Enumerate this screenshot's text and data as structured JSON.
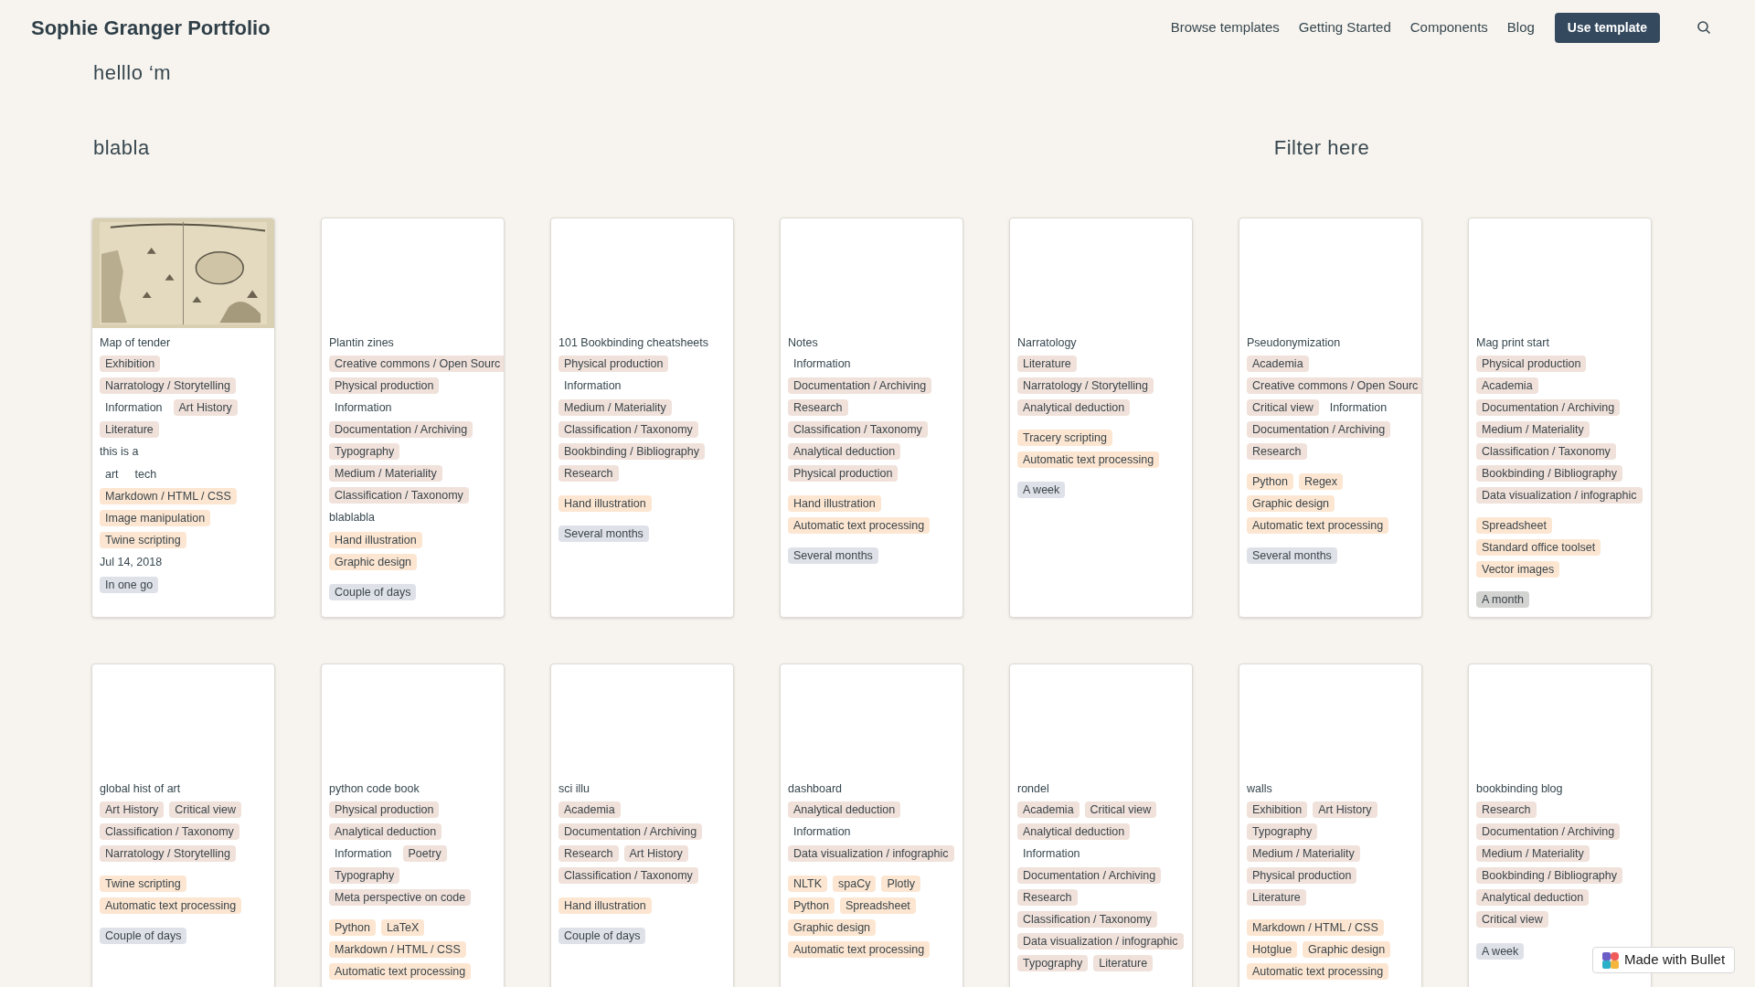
{
  "header": {
    "title": "Sophie Granger Portfolio",
    "nav": [
      "Browse templates",
      "Getting Started",
      "Components",
      "Blog"
    ],
    "cta": "Use template"
  },
  "greeting": "helllo ‘m",
  "section_title": "blabla",
  "filter_label": "Filter here",
  "cards": [
    {
      "title": "Map of tender",
      "image": {
        "kind": "picture"
      },
      "groups": [
        {
          "kind": "tags",
          "color": "#f0e1da",
          "tags": [
            {
              "label": "Exhibition",
              "kind": "pill"
            },
            {
              "label": "Narratology / Storytelling",
              "kind": "pill"
            },
            {
              "label": "Information",
              "kind": "plain"
            },
            {
              "label": "Art History",
              "kind": "pill"
            },
            {
              "label": "Literature",
              "kind": "pill"
            }
          ]
        },
        {
          "kind": "text",
          "text": "this is a"
        },
        {
          "kind": "tags",
          "color": "#fce6d1",
          "tags": [
            {
              "label": "art",
              "kind": "plain"
            },
            {
              "label": "tech",
              "kind": "plain"
            },
            {
              "label": "Markdown / HTML / CSS",
              "kind": "pill"
            },
            {
              "label": "Image manipulation",
              "kind": "pill"
            },
            {
              "label": "Twine scripting",
              "kind": "pill"
            }
          ]
        },
        {
          "kind": "text",
          "text": "Jul 14, 2018"
        },
        {
          "kind": "tags",
          "color": "#dfe1e9",
          "tags": [
            {
              "label": "In one go",
              "kind": "pill"
            }
          ]
        }
      ]
    },
    {
      "title": "Plantin zines",
      "groups": [
        {
          "kind": "tags",
          "color": "#f0e1da",
          "tags": [
            {
              "label": "Creative commons / Open Sourc",
              "kind": "pill"
            },
            {
              "label": "Physical production",
              "kind": "pill"
            },
            {
              "label": "Information",
              "kind": "plain"
            },
            {
              "label": "Documentation / Archiving",
              "kind": "pill"
            },
            {
              "label": "Typography",
              "kind": "pill"
            },
            {
              "label": "Medium / Materiality",
              "kind": "pill"
            },
            {
              "label": "Classification / Taxonomy",
              "kind": "pill"
            }
          ]
        },
        {
          "kind": "text",
          "text": "blablabla"
        },
        {
          "kind": "tags",
          "color": "#fce6d1",
          "tags": [
            {
              "label": "Hand illustration",
              "kind": "pill"
            },
            {
              "label": "Graphic design",
              "kind": "pill"
            }
          ]
        },
        {
          "kind": "tags",
          "color": "#dfe1e9",
          "tags": [
            {
              "label": "Couple of days",
              "kind": "pill"
            }
          ]
        }
      ]
    },
    {
      "title": "101 Bookbinding cheatsheets",
      "groups": [
        {
          "kind": "tags",
          "color": "#f0e1da",
          "tags": [
            {
              "label": "Physical production",
              "kind": "pill"
            },
            {
              "label": "Information",
              "kind": "plain"
            },
            {
              "label": "Medium / Materiality",
              "kind": "pill"
            },
            {
              "label": "Classification / Taxonomy",
              "kind": "pill"
            },
            {
              "label": "Bookbinding / Bibliography",
              "kind": "pill"
            },
            {
              "label": "Research",
              "kind": "pill"
            }
          ]
        },
        {
          "kind": "tags",
          "color": "#fce6d1",
          "tags": [
            {
              "label": "Hand illustration",
              "kind": "pill"
            }
          ]
        },
        {
          "kind": "tags",
          "color": "#dfe1e9",
          "tags": [
            {
              "label": "Several months",
              "kind": "pill"
            }
          ]
        }
      ]
    },
    {
      "title": "Notes",
      "groups": [
        {
          "kind": "tags",
          "color": "#f0e1da",
          "tags": [
            {
              "label": "Information",
              "kind": "plain"
            },
            {
              "label": "Documentation / Archiving",
              "kind": "pill"
            },
            {
              "label": "Research",
              "kind": "pill"
            },
            {
              "label": "Classification / Taxonomy",
              "kind": "pill"
            },
            {
              "label": "Analytical deduction",
              "kind": "pill"
            },
            {
              "label": "Physical production",
              "kind": "pill"
            }
          ]
        },
        {
          "kind": "tags",
          "color": "#fce6d1",
          "tags": [
            {
              "label": "Hand illustration",
              "kind": "pill"
            },
            {
              "label": "Automatic text processing",
              "kind": "pill"
            }
          ]
        },
        {
          "kind": "tags",
          "color": "#dfe1e9",
          "tags": [
            {
              "label": "Several months",
              "kind": "pill"
            }
          ]
        }
      ]
    },
    {
      "title": "Narratology",
      "groups": [
        {
          "kind": "tags",
          "color": "#f0e1da",
          "tags": [
            {
              "label": "Literature",
              "kind": "pill"
            },
            {
              "label": "Narratology / Storytelling",
              "kind": "pill"
            },
            {
              "label": "Analytical deduction",
              "kind": "pill"
            }
          ]
        },
        {
          "kind": "tags",
          "color": "#fce6d1",
          "tags": [
            {
              "label": "Tracery scripting",
              "kind": "pill"
            },
            {
              "label": "Automatic text processing",
              "kind": "pill"
            }
          ]
        },
        {
          "kind": "tags",
          "color": "#dfe1e9",
          "tags": [
            {
              "label": "A week",
              "kind": "pill"
            }
          ]
        }
      ]
    },
    {
      "title": "Pseudonymization",
      "groups": [
        {
          "kind": "tags",
          "color": "#f0e1da",
          "tags": [
            {
              "label": "Academia",
              "kind": "pill"
            },
            {
              "label": "Creative commons / Open Sourc",
              "kind": "pill"
            },
            {
              "label": "Critical view",
              "kind": "pill"
            },
            {
              "label": "Information",
              "kind": "plain"
            },
            {
              "label": "Documentation / Archiving",
              "kind": "pill"
            },
            {
              "label": "Research",
              "kind": "pill"
            }
          ]
        },
        {
          "kind": "tags",
          "color": "#fce6d1",
          "tags": [
            {
              "label": "Python",
              "kind": "pill"
            },
            {
              "label": "Regex",
              "kind": "pill"
            },
            {
              "label": "Graphic design",
              "kind": "pill"
            },
            {
              "label": "Automatic text processing",
              "kind": "pill"
            }
          ]
        },
        {
          "kind": "tags",
          "color": "#dfe1e9",
          "tags": [
            {
              "label": "Several months",
              "kind": "pill"
            }
          ]
        }
      ]
    },
    {
      "title": "Mag print start",
      "groups": [
        {
          "kind": "tags",
          "color": "#f0e1da",
          "tags": [
            {
              "label": "Physical production",
              "kind": "pill"
            },
            {
              "label": "Academia",
              "kind": "pill"
            },
            {
              "label": "Documentation / Archiving",
              "kind": "pill"
            },
            {
              "label": "Medium / Materiality",
              "kind": "pill"
            },
            {
              "label": "Classification / Taxonomy",
              "kind": "pill"
            },
            {
              "label": "Bookbinding / Bibliography",
              "kind": "pill"
            },
            {
              "label": "Data visualization / infographic",
              "kind": "pill"
            }
          ]
        },
        {
          "kind": "tags",
          "color": "#fce6d1",
          "tags": [
            {
              "label": "Spreadsheet",
              "kind": "pill"
            },
            {
              "label": "Standard office toolset",
              "kind": "pill"
            },
            {
              "label": "Vector images",
              "kind": "pill"
            }
          ]
        },
        {
          "kind": "tags",
          "color": "#d3d3d1",
          "tags": [
            {
              "label": "A month",
              "kind": "pill"
            }
          ]
        }
      ]
    },
    {
      "title": "global hist of art",
      "groups": [
        {
          "kind": "tags",
          "color": "#f0e1da",
          "tags": [
            {
              "label": "Art History",
              "kind": "pill"
            },
            {
              "label": "Critical view",
              "kind": "pill"
            },
            {
              "label": "Classification / Taxonomy",
              "kind": "pill"
            },
            {
              "label": "Narratology / Storytelling",
              "kind": "pill"
            }
          ]
        },
        {
          "kind": "tags",
          "color": "#fce6d1",
          "tags": [
            {
              "label": "Twine scripting",
              "kind": "pill"
            },
            {
              "label": "Automatic text processing",
              "kind": "pill"
            }
          ]
        },
        {
          "kind": "tags",
          "color": "#dfe1e9",
          "tags": [
            {
              "label": "Couple of days",
              "kind": "pill"
            }
          ]
        }
      ]
    },
    {
      "title": "python code book",
      "groups": [
        {
          "kind": "tags",
          "color": "#f0e1da",
          "tags": [
            {
              "label": "Physical production",
              "kind": "pill"
            },
            {
              "label": "Analytical deduction",
              "kind": "pill"
            },
            {
              "label": "Information",
              "kind": "plain"
            },
            {
              "label": "Poetry",
              "kind": "pill"
            },
            {
              "label": "Typography",
              "kind": "pill"
            },
            {
              "label": "Meta perspective on code",
              "kind": "pill"
            }
          ]
        },
        {
          "kind": "tags",
          "color": "#fce6d1",
          "tags": [
            {
              "label": "Python",
              "kind": "pill"
            },
            {
              "label": "LaTeX",
              "kind": "pill"
            },
            {
              "label": "Markdown / HTML / CSS",
              "kind": "pill"
            },
            {
              "label": "Automatic text processing",
              "kind": "pill"
            }
          ]
        }
      ]
    },
    {
      "title": "sci illu",
      "groups": [
        {
          "kind": "tags",
          "color": "#f0e1da",
          "tags": [
            {
              "label": "Academia",
              "kind": "pill"
            },
            {
              "label": "Documentation / Archiving",
              "kind": "pill"
            },
            {
              "label": "Research",
              "kind": "pill"
            },
            {
              "label": "Art History",
              "kind": "pill"
            },
            {
              "label": "Classification / Taxonomy",
              "kind": "pill"
            }
          ]
        },
        {
          "kind": "tags",
          "color": "#fce6d1",
          "tags": [
            {
              "label": "Hand illustration",
              "kind": "pill"
            }
          ]
        },
        {
          "kind": "tags",
          "color": "#dfe1e9",
          "tags": [
            {
              "label": "Couple of days",
              "kind": "pill"
            }
          ]
        }
      ]
    },
    {
      "title": "dashboard",
      "groups": [
        {
          "kind": "tags",
          "color": "#f0e1da",
          "tags": [
            {
              "label": "Analytical deduction",
              "kind": "pill"
            },
            {
              "label": "Information",
              "kind": "plain"
            },
            {
              "label": "Data visualization / infographic",
              "kind": "pill"
            }
          ]
        },
        {
          "kind": "tags",
          "color": "#fce6d1",
          "tags": [
            {
              "label": "NLTK",
              "kind": "pill"
            },
            {
              "label": "spaCy",
              "kind": "pill"
            },
            {
              "label": "Plotly",
              "kind": "pill"
            },
            {
              "label": "Python",
              "kind": "pill"
            },
            {
              "label": "Spreadsheet",
              "kind": "pill"
            },
            {
              "label": "Graphic design",
              "kind": "pill"
            },
            {
              "label": "Automatic text processing",
              "kind": "pill"
            }
          ]
        }
      ]
    },
    {
      "title": "rondel",
      "groups": [
        {
          "kind": "tags",
          "color": "#f0e1da",
          "tags": [
            {
              "label": "Academia",
              "kind": "pill"
            },
            {
              "label": "Critical view",
              "kind": "pill"
            },
            {
              "label": "Analytical deduction",
              "kind": "pill"
            },
            {
              "label": "Information",
              "kind": "plain"
            },
            {
              "label": "Documentation / Archiving",
              "kind": "pill"
            },
            {
              "label": "Research",
              "kind": "pill"
            },
            {
              "label": "Classification / Taxonomy",
              "kind": "pill"
            },
            {
              "label": "Data visualization / infographic",
              "kind": "pill"
            },
            {
              "label": "Typography",
              "kind": "pill"
            },
            {
              "label": "Literature",
              "kind": "pill"
            }
          ]
        }
      ]
    },
    {
      "title": "walls",
      "groups": [
        {
          "kind": "tags",
          "color": "#f0e1da",
          "tags": [
            {
              "label": "Exhibition",
              "kind": "pill"
            },
            {
              "label": "Art History",
              "kind": "pill"
            },
            {
              "label": "Typography",
              "kind": "pill"
            },
            {
              "label": "Medium / Materiality",
              "kind": "pill"
            },
            {
              "label": "Physical production",
              "kind": "pill"
            },
            {
              "label": "Literature",
              "kind": "pill"
            }
          ]
        },
        {
          "kind": "tags",
          "color": "#fce6d1",
          "tags": [
            {
              "label": "Markdown / HTML / CSS",
              "kind": "pill"
            },
            {
              "label": "Hotglue",
              "kind": "pill"
            },
            {
              "label": "Graphic design",
              "kind": "pill"
            },
            {
              "label": "Automatic text processing",
              "kind": "pill"
            }
          ]
        }
      ]
    },
    {
      "title": "bookbinding blog",
      "groups": [
        {
          "kind": "tags",
          "color": "#f0e1da",
          "tags": [
            {
              "label": "Research",
              "kind": "pill"
            },
            {
              "label": "Documentation / Archiving",
              "kind": "pill"
            },
            {
              "label": "Medium / Materiality",
              "kind": "pill"
            },
            {
              "label": "Bookbinding / Bibliography",
              "kind": "pill"
            },
            {
              "label": "Analytical deduction",
              "kind": "pill"
            },
            {
              "label": "Critical view",
              "kind": "pill"
            }
          ]
        },
        {
          "kind": "gap"
        },
        {
          "kind": "tags",
          "color": "#dfe1e9",
          "tags": [
            {
              "label": "A week",
              "kind": "pill"
            }
          ]
        }
      ]
    }
  ],
  "badge": "Made with Bullet"
}
